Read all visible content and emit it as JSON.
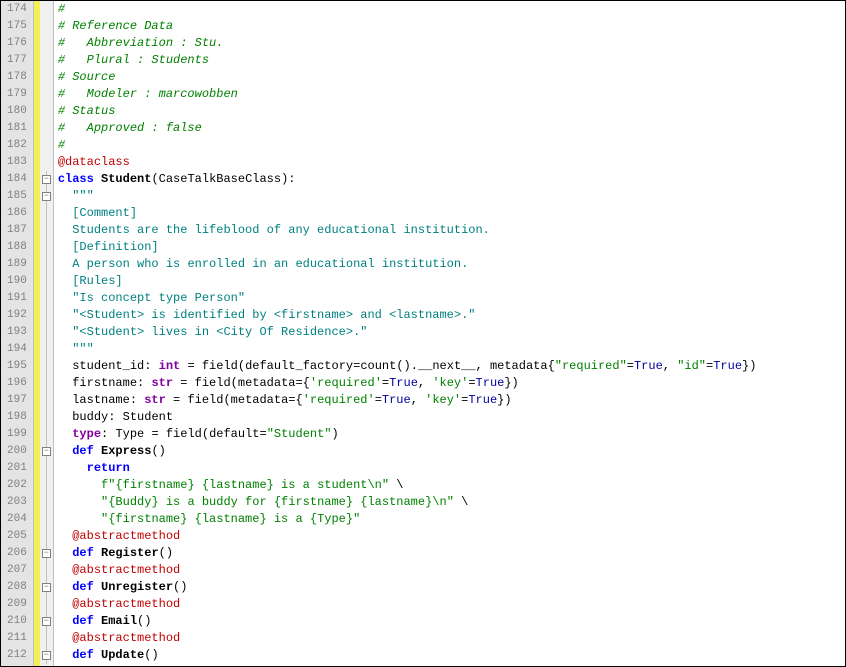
{
  "lines": [
    {
      "num": "174",
      "fold": "none",
      "marker": true,
      "tokens": [
        [
          "tok-comment",
          "#"
        ]
      ]
    },
    {
      "num": "175",
      "fold": "none",
      "marker": true,
      "tokens": [
        [
          "tok-comment",
          "# Reference Data"
        ]
      ]
    },
    {
      "num": "176",
      "fold": "none",
      "marker": true,
      "tokens": [
        [
          "tok-comment",
          "#   Abbreviation : Stu."
        ]
      ]
    },
    {
      "num": "177",
      "fold": "none",
      "marker": true,
      "tokens": [
        [
          "tok-comment",
          "#   Plural : Students"
        ]
      ]
    },
    {
      "num": "178",
      "fold": "none",
      "marker": true,
      "tokens": [
        [
          "tok-comment",
          "# Source"
        ]
      ]
    },
    {
      "num": "179",
      "fold": "none",
      "marker": true,
      "tokens": [
        [
          "tok-comment",
          "#   Modeler : marcowobben"
        ]
      ]
    },
    {
      "num": "180",
      "fold": "none",
      "marker": true,
      "tokens": [
        [
          "tok-comment",
          "# Status"
        ]
      ]
    },
    {
      "num": "181",
      "fold": "none",
      "marker": true,
      "tokens": [
        [
          "tok-comment",
          "#   Approved : false"
        ]
      ]
    },
    {
      "num": "182",
      "fold": "none",
      "marker": true,
      "tokens": [
        [
          "tok-comment",
          "#"
        ]
      ]
    },
    {
      "num": "183",
      "fold": "none",
      "marker": true,
      "tokens": [
        [
          "tok-decorator",
          "@dataclass"
        ]
      ]
    },
    {
      "num": "184",
      "fold": "box",
      "marker": true,
      "tokens": [
        [
          "tok-keyword",
          "class"
        ],
        [
          "tok-name",
          " "
        ],
        [
          "tok-classname",
          "Student"
        ],
        [
          "tok-punct",
          "("
        ],
        [
          "tok-name",
          "CaseTalkBaseClass"
        ],
        [
          "tok-punct",
          "):"
        ]
      ]
    },
    {
      "num": "185",
      "fold": "box",
      "marker": true,
      "tokens": [
        [
          "tok-name",
          "  "
        ],
        [
          "tok-docstring",
          "\"\"\""
        ]
      ]
    },
    {
      "num": "186",
      "fold": "line",
      "marker": true,
      "tokens": [
        [
          "tok-name",
          "  "
        ],
        [
          "tok-docstring",
          "[Comment]"
        ]
      ]
    },
    {
      "num": "187",
      "fold": "line",
      "marker": true,
      "tokens": [
        [
          "tok-name",
          "  "
        ],
        [
          "tok-docstring",
          "Students are the lifeblood of any educational institution."
        ]
      ]
    },
    {
      "num": "188",
      "fold": "line",
      "marker": true,
      "tokens": [
        [
          "tok-name",
          "  "
        ],
        [
          "tok-docstring",
          "[Definition]"
        ]
      ]
    },
    {
      "num": "189",
      "fold": "line",
      "marker": true,
      "tokens": [
        [
          "tok-name",
          "  "
        ],
        [
          "tok-docstring",
          "A person who is enrolled in an educational institution."
        ]
      ]
    },
    {
      "num": "190",
      "fold": "line",
      "marker": true,
      "tokens": [
        [
          "tok-name",
          "  "
        ],
        [
          "tok-docstring",
          "[Rules]"
        ]
      ]
    },
    {
      "num": "191",
      "fold": "line",
      "marker": true,
      "tokens": [
        [
          "tok-name",
          "  "
        ],
        [
          "tok-docstring",
          "\"Is concept type Person\""
        ]
      ]
    },
    {
      "num": "192",
      "fold": "line",
      "marker": true,
      "tokens": [
        [
          "tok-name",
          "  "
        ],
        [
          "tok-docstring",
          "\"<Student> is identified by <firstname> and <lastname>.\""
        ]
      ]
    },
    {
      "num": "193",
      "fold": "line",
      "marker": true,
      "tokens": [
        [
          "tok-name",
          "  "
        ],
        [
          "tok-docstring",
          "\"<Student> lives in <City Of Residence>.\""
        ]
      ]
    },
    {
      "num": "194",
      "fold": "line",
      "marker": true,
      "tokens": [
        [
          "tok-name",
          "  "
        ],
        [
          "tok-docstring",
          "\"\"\""
        ]
      ]
    },
    {
      "num": "195",
      "fold": "line",
      "marker": true,
      "tokens": [
        [
          "tok-name",
          "  student_id"
        ],
        [
          "tok-punct",
          ": "
        ],
        [
          "tok-type",
          "int"
        ],
        [
          "tok-punct",
          " = "
        ],
        [
          "tok-name",
          "field"
        ],
        [
          "tok-punct",
          "("
        ],
        [
          "tok-name",
          "default_factory"
        ],
        [
          "tok-punct",
          "="
        ],
        [
          "tok-name",
          "count"
        ],
        [
          "tok-punct",
          "()."
        ],
        [
          "tok-name",
          "__next__"
        ],
        [
          "tok-punct",
          ", "
        ],
        [
          "tok-name",
          "metadata"
        ],
        [
          "tok-punct",
          "{"
        ],
        [
          "tok-string",
          "\"required\""
        ],
        [
          "tok-punct",
          "="
        ],
        [
          "tok-builtin",
          "True"
        ],
        [
          "tok-punct",
          ", "
        ],
        [
          "tok-string",
          "\"id\""
        ],
        [
          "tok-punct",
          "="
        ],
        [
          "tok-builtin",
          "True"
        ],
        [
          "tok-punct",
          "})"
        ]
      ]
    },
    {
      "num": "196",
      "fold": "line",
      "marker": true,
      "tokens": [
        [
          "tok-name",
          "  firstname"
        ],
        [
          "tok-punct",
          ": "
        ],
        [
          "tok-type",
          "str"
        ],
        [
          "tok-punct",
          " = "
        ],
        [
          "tok-name",
          "field"
        ],
        [
          "tok-punct",
          "("
        ],
        [
          "tok-name",
          "metadata"
        ],
        [
          "tok-punct",
          "={"
        ],
        [
          "tok-string",
          "'required'"
        ],
        [
          "tok-punct",
          "="
        ],
        [
          "tok-builtin",
          "True"
        ],
        [
          "tok-punct",
          ", "
        ],
        [
          "tok-string",
          "'key'"
        ],
        [
          "tok-punct",
          "="
        ],
        [
          "tok-builtin",
          "True"
        ],
        [
          "tok-punct",
          "})"
        ]
      ]
    },
    {
      "num": "197",
      "fold": "line",
      "marker": true,
      "tokens": [
        [
          "tok-name",
          "  lastname"
        ],
        [
          "tok-punct",
          ": "
        ],
        [
          "tok-type",
          "str"
        ],
        [
          "tok-punct",
          " = "
        ],
        [
          "tok-name",
          "field"
        ],
        [
          "tok-punct",
          "("
        ],
        [
          "tok-name",
          "metadata"
        ],
        [
          "tok-punct",
          "={"
        ],
        [
          "tok-string",
          "'required'"
        ],
        [
          "tok-punct",
          "="
        ],
        [
          "tok-builtin",
          "True"
        ],
        [
          "tok-punct",
          ", "
        ],
        [
          "tok-string",
          "'key'"
        ],
        [
          "tok-punct",
          "="
        ],
        [
          "tok-builtin",
          "True"
        ],
        [
          "tok-punct",
          "})"
        ]
      ]
    },
    {
      "num": "198",
      "fold": "line",
      "marker": true,
      "tokens": [
        [
          "tok-name",
          "  buddy"
        ],
        [
          "tok-punct",
          ": "
        ],
        [
          "tok-name",
          "Student"
        ]
      ]
    },
    {
      "num": "199",
      "fold": "line",
      "marker": true,
      "tokens": [
        [
          "tok-name",
          "  "
        ],
        [
          "tok-type",
          "type"
        ],
        [
          "tok-punct",
          ": "
        ],
        [
          "tok-name",
          "Type"
        ],
        [
          "tok-punct",
          " = "
        ],
        [
          "tok-name",
          "field"
        ],
        [
          "tok-punct",
          "("
        ],
        [
          "tok-name",
          "default"
        ],
        [
          "tok-punct",
          "="
        ],
        [
          "tok-string",
          "\"Student\""
        ],
        [
          "tok-punct",
          ")"
        ]
      ]
    },
    {
      "num": "200",
      "fold": "box",
      "marker": true,
      "tokens": [
        [
          "tok-name",
          "  "
        ],
        [
          "tok-keyword",
          "def"
        ],
        [
          "tok-name",
          " "
        ],
        [
          "tok-funcname",
          "Express"
        ],
        [
          "tok-punct",
          "()"
        ]
      ]
    },
    {
      "num": "201",
      "fold": "line",
      "marker": true,
      "tokens": [
        [
          "tok-name",
          "    "
        ],
        [
          "tok-keyword",
          "return"
        ]
      ]
    },
    {
      "num": "202",
      "fold": "line",
      "marker": true,
      "tokens": [
        [
          "tok-name",
          "      "
        ],
        [
          "tok-string",
          "f\"{firstname} {lastname} is a student\\n\""
        ],
        [
          "tok-punct",
          " \\"
        ]
      ]
    },
    {
      "num": "203",
      "fold": "line",
      "marker": true,
      "tokens": [
        [
          "tok-name",
          "      "
        ],
        [
          "tok-string",
          "\"{Buddy} is a buddy for {firstname} {lastname}\\n\""
        ],
        [
          "tok-punct",
          " \\"
        ]
      ]
    },
    {
      "num": "204",
      "fold": "line",
      "marker": true,
      "tokens": [
        [
          "tok-name",
          "      "
        ],
        [
          "tok-string",
          "\"{firstname} {lastname} is a {Type}\""
        ]
      ]
    },
    {
      "num": "205",
      "fold": "line",
      "marker": true,
      "tokens": [
        [
          "tok-name",
          "  "
        ],
        [
          "tok-decorator",
          "@abstractmethod"
        ]
      ]
    },
    {
      "num": "206",
      "fold": "box",
      "marker": true,
      "tokens": [
        [
          "tok-name",
          "  "
        ],
        [
          "tok-keyword",
          "def"
        ],
        [
          "tok-name",
          " "
        ],
        [
          "tok-funcname",
          "Register"
        ],
        [
          "tok-punct",
          "()"
        ]
      ]
    },
    {
      "num": "207",
      "fold": "line",
      "marker": true,
      "tokens": [
        [
          "tok-name",
          "  "
        ],
        [
          "tok-decorator",
          "@abstractmethod"
        ]
      ]
    },
    {
      "num": "208",
      "fold": "box",
      "marker": true,
      "tokens": [
        [
          "tok-name",
          "  "
        ],
        [
          "tok-keyword",
          "def"
        ],
        [
          "tok-name",
          " "
        ],
        [
          "tok-funcname",
          "Unregister"
        ],
        [
          "tok-punct",
          "()"
        ]
      ]
    },
    {
      "num": "209",
      "fold": "line",
      "marker": true,
      "tokens": [
        [
          "tok-name",
          "  "
        ],
        [
          "tok-decorator",
          "@abstractmethod"
        ]
      ]
    },
    {
      "num": "210",
      "fold": "box",
      "marker": true,
      "tokens": [
        [
          "tok-name",
          "  "
        ],
        [
          "tok-keyword",
          "def"
        ],
        [
          "tok-name",
          " "
        ],
        [
          "tok-funcname",
          "Email"
        ],
        [
          "tok-punct",
          "()"
        ]
      ]
    },
    {
      "num": "211",
      "fold": "line",
      "marker": true,
      "tokens": [
        [
          "tok-name",
          "  "
        ],
        [
          "tok-decorator",
          "@abstractmethod"
        ]
      ]
    },
    {
      "num": "212",
      "fold": "box",
      "marker": true,
      "tokens": [
        [
          "tok-name",
          "  "
        ],
        [
          "tok-keyword",
          "def"
        ],
        [
          "tok-name",
          " "
        ],
        [
          "tok-funcname",
          "Update"
        ],
        [
          "tok-punct",
          "()"
        ]
      ]
    }
  ]
}
